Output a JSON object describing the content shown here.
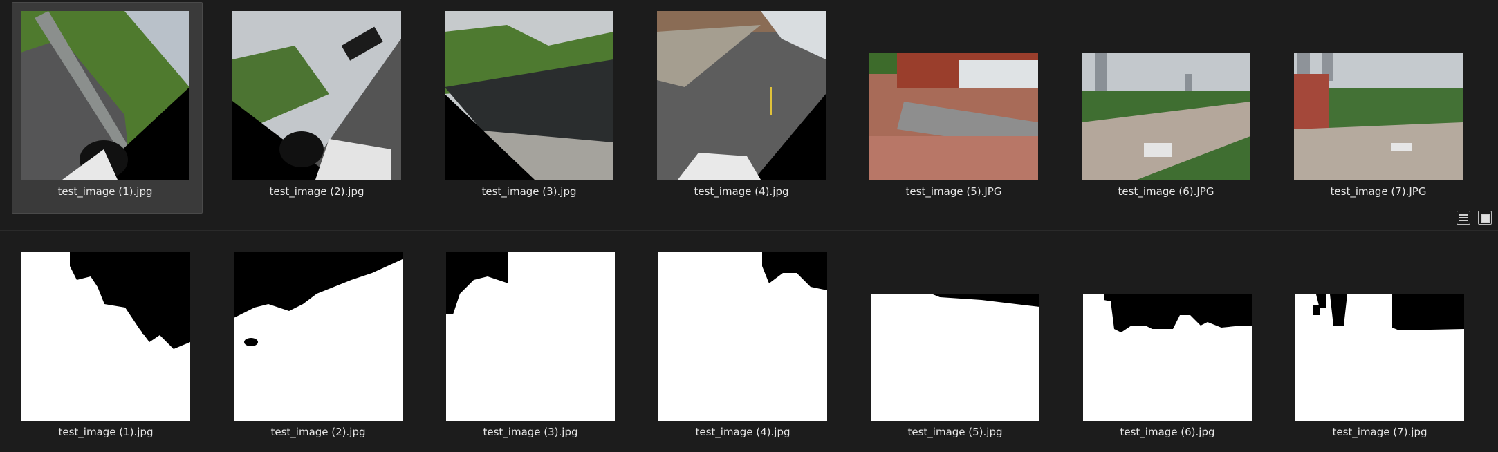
{
  "top_row": {
    "items": [
      {
        "filename": "test_image (1).jpg",
        "selected": true
      },
      {
        "filename": "test_image (2).jpg",
        "selected": false
      },
      {
        "filename": "test_image (3).jpg",
        "selected": false
      },
      {
        "filename": "test_image (4).jpg",
        "selected": false
      },
      {
        "filename": "test_image (5).JPG",
        "selected": false
      },
      {
        "filename": "test_image (6).JPG",
        "selected": false
      },
      {
        "filename": "test_image (7).JPG",
        "selected": false
      }
    ]
  },
  "bottom_row": {
    "items": [
      {
        "filename": "test_image (1).jpg"
      },
      {
        "filename": "test_image (2).jpg"
      },
      {
        "filename": "test_image (3).jpg"
      },
      {
        "filename": "test_image (4).jpg"
      },
      {
        "filename": "test_image (5).jpg"
      },
      {
        "filename": "test_image (6).jpg"
      },
      {
        "filename": "test_image (7).jpg"
      }
    ]
  },
  "toolbar": {
    "list_view_icon": "list-view-icon",
    "grid_view_icon": "grid-view-icon"
  },
  "colors": {
    "background": "#1c1c1c",
    "selection": "#3a3a3a",
    "label_text": "#e6e6e6"
  }
}
